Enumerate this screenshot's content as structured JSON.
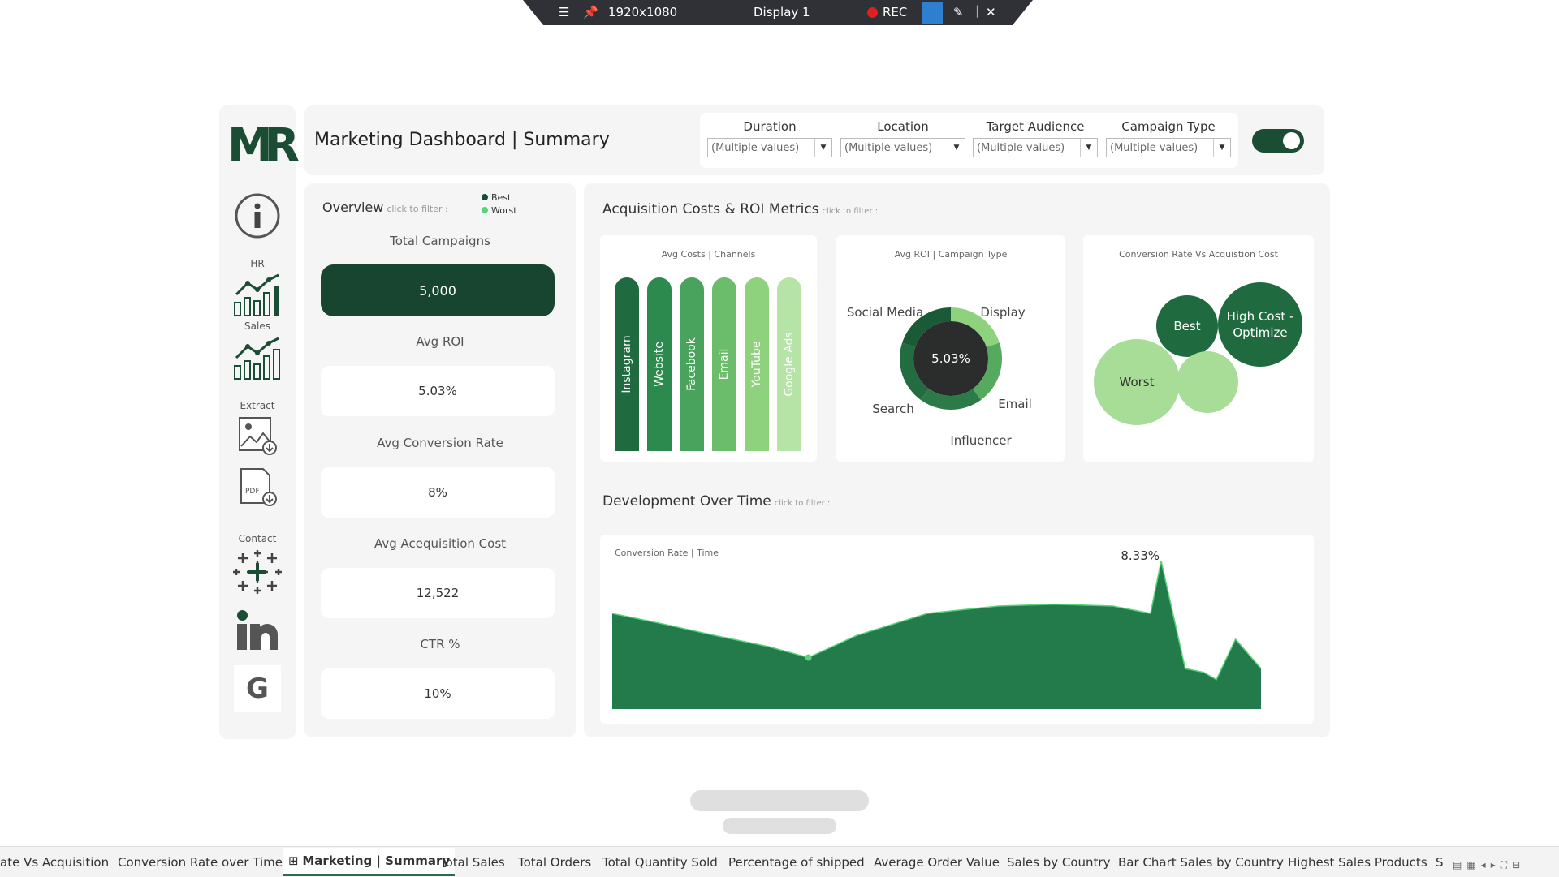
{
  "recorder": {
    "resolution": "1920x1080",
    "display": "Display 1",
    "rec_label": "REC"
  },
  "logo": "MR",
  "sidebar": {
    "hr_label": "HR",
    "sales_label": "Sales",
    "extract_label": "Extract",
    "contact_label": "Contact",
    "g_label": "G"
  },
  "header": {
    "title": "Marketing Dashboard | Summary"
  },
  "filters": [
    {
      "label": "Duration",
      "value": "(Multiple values)"
    },
    {
      "label": "Location",
      "value": "(Multiple values)"
    },
    {
      "label": "Target Audience",
      "value": "(Multiple values)"
    },
    {
      "label": "Campaign Type",
      "value": "(Multiple values)"
    }
  ],
  "overview": {
    "title": "Overview",
    "hint": "click to filter :",
    "legend_best": "Best",
    "legend_worst": "Worst",
    "kpis": [
      {
        "label": "Total Campaigns",
        "value": "5,000"
      },
      {
        "label": "Avg ROI",
        "value": "5.03%"
      },
      {
        "label": "Avg Conversion Rate",
        "value": "8%"
      },
      {
        "label": "Avg Acequisition Cost",
        "value": "12,522"
      },
      {
        "label": "CTR %",
        "value": "10%"
      }
    ]
  },
  "acquisition": {
    "title": "Acquisition Costs & ROI Metrics",
    "hint": "click to filter :"
  },
  "development": {
    "title": "Development Over Time",
    "hint": "click to filter :"
  },
  "colors": {
    "dark_green": "#1a4d33",
    "green": "#237a4b",
    "mid_green": "#3e9b58",
    "light_green": "#a7dd96",
    "accent": "#55d47a"
  },
  "chart_data": [
    {
      "type": "bar",
      "title": "Avg Costs | Channels",
      "categories": [
        "Instagram",
        "Website",
        "Facebook",
        "Email",
        "YouTube",
        "Google Ads"
      ],
      "colors": [
        "#1f6b3f",
        "#2d8a4e",
        "#4aa35c",
        "#6bbd6b",
        "#8fd27e",
        "#b6e4a6"
      ]
    },
    {
      "type": "pie",
      "title": "Avg ROI | Campaign Type",
      "categories": [
        "Display",
        "Email",
        "Influencer",
        "Search",
        "Social Media"
      ],
      "center_label": "5.03%"
    },
    {
      "type": "scatter",
      "title": "Conversion Rate Vs Acquistion Cost",
      "labels": [
        "Best",
        "High Cost - Optimize",
        "Worst",
        ""
      ]
    },
    {
      "type": "area",
      "title": "Conversion Rate | Time",
      "values": [
        6.9,
        6.6,
        6.3,
        6.0,
        5.7,
        6.3,
        6.9,
        7.1,
        7.15,
        7.1,
        6.9,
        8.33,
        5.4,
        5.3,
        5.1,
        6.2,
        5.4
      ],
      "peak_label": "8.33%",
      "ylim": [
        4.3,
        8.6
      ]
    }
  ],
  "tabs": [
    "ate Vs Acquisition",
    "Conversion Rate over Time",
    "Marketing | Summary",
    "Total Sales",
    "Total Orders",
    "Total Quantity Sold",
    "Percentage of shipped",
    "Average Order Value",
    "Sales by Country",
    "Bar Chart Sales by Country",
    "Highest Sales Products",
    "S"
  ]
}
